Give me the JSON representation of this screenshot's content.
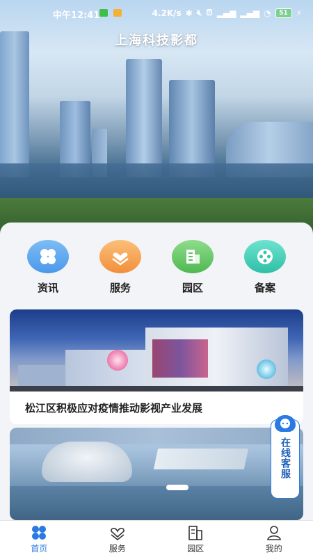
{
  "status_bar": {
    "time": "中午12:41",
    "network_speed": "4.2K/s",
    "battery": "51"
  },
  "hero": {
    "title": "上海科技影都"
  },
  "quick_links": [
    {
      "label": "资讯",
      "icon": "clover-icon",
      "color": "#5aa7f0"
    },
    {
      "label": "服务",
      "icon": "heart-hands-icon",
      "color": "#f7a34d"
    },
    {
      "label": "园区",
      "icon": "building-icon",
      "color": "#69c96b"
    },
    {
      "label": "备案",
      "icon": "film-reel-icon",
      "color": "#3ec9b3"
    }
  ],
  "news": [
    {
      "title": "松江区积极应对疫情推动影视产业发展"
    },
    {
      "title": ""
    }
  ],
  "customer_service": {
    "label": "在线客服"
  },
  "tabs": [
    {
      "label": "首页",
      "icon": "home-clover-icon"
    },
    {
      "label": "服务",
      "icon": "heart-icon"
    },
    {
      "label": "园区",
      "icon": "building-icon"
    },
    {
      "label": "我的",
      "icon": "user-icon"
    }
  ],
  "colors": {
    "accent": "#2a7ae2"
  }
}
